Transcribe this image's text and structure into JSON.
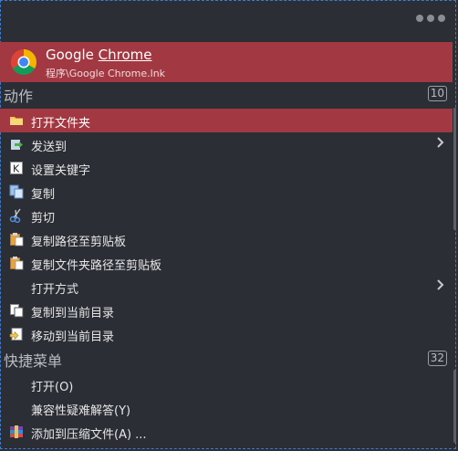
{
  "header": {
    "more_icon": "more-dots-icon"
  },
  "result": {
    "title_plain": "Google ",
    "title_highlight": "Chrome",
    "subtitle": "程序\\Google Chrome.lnk",
    "icon": "chrome-icon"
  },
  "actions": {
    "label": "动作",
    "count": "10",
    "items": [
      {
        "label": "打开文件夹",
        "icon": "folder-icon",
        "selected": true
      },
      {
        "label": "发送到",
        "icon": "send-to-icon",
        "submenu": true
      },
      {
        "label": "设置关键字",
        "icon": "keyword-icon"
      },
      {
        "label": "复制",
        "icon": "copy-icon"
      },
      {
        "label": "剪切",
        "icon": "scissors-icon"
      },
      {
        "label": "复制路径至剪贴板",
        "icon": "clipboard-icon"
      },
      {
        "label": "复制文件夹路径至剪贴板",
        "icon": "clipboard-icon"
      },
      {
        "label": "打开方式",
        "icon": "",
        "submenu": true
      },
      {
        "label": "复制到当前目录",
        "icon": "copy-to-icon"
      },
      {
        "label": "移动到当前目录",
        "icon": "move-to-icon"
      }
    ]
  },
  "shortcuts": {
    "label": "快捷菜单",
    "count": "32",
    "items": [
      {
        "label": "打开(O)"
      },
      {
        "label": "兼容性疑难解答(Y)"
      },
      {
        "label": "添加到压缩文件(A) ...",
        "icon": "archive-icon"
      }
    ]
  },
  "colors": {
    "accent": "#a23942",
    "background": "#2b2e35"
  }
}
